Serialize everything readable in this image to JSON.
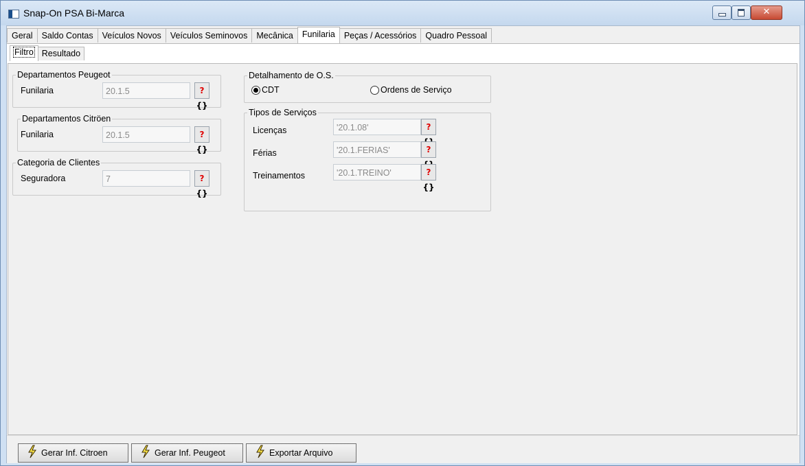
{
  "window": {
    "title": "Snap-On PSA Bi-Marca",
    "close_glyph": "✕"
  },
  "main_tabs": [
    "Geral",
    "Saldo Contas",
    "Veículos Novos",
    "Veículos Seminovos",
    "Mecânica",
    "Funilaria",
    "Peças / Acessórios",
    "Quadro Pessoal"
  ],
  "active_main_tab": "Funilaria",
  "sub_tabs": [
    "Filtro",
    "Resultado"
  ],
  "active_sub_tab": "Filtro",
  "groups": {
    "peugeot": {
      "legend": "Departamentos Peugeot",
      "label": "Funilaria",
      "value": "20.1.5"
    },
    "citroen": {
      "legend": "Departamentos Citröen",
      "label": "Funilaria",
      "value": "20.1.5"
    },
    "clientes": {
      "legend": "Categoria de Clientes",
      "label": "Seguradora",
      "value": "7"
    },
    "detalhamento": {
      "legend": "Detalhamento de O.S.",
      "option_cdt": "CDT",
      "option_os": "Ordens de Serviço",
      "selected": "CDT"
    },
    "servicos": {
      "legend": "Tipos de Serviços",
      "rows": [
        {
          "label": "Licenças",
          "value": "'20.1.08'"
        },
        {
          "label": "Férias",
          "value": "'20.1.FERIAS'"
        },
        {
          "label": "Treinamentos",
          "value": "'20.1.TREINO'"
        }
      ]
    }
  },
  "lookup_button": {
    "q": "?",
    "brace": "{}"
  },
  "buttons": {
    "gerar_citroen": "Gerar Inf. Citroen",
    "gerar_peugeot": "Gerar Inf. Peugeot",
    "exportar": "Exportar Arquivo"
  },
  "icons": {
    "app": "app-window-icon",
    "lookup": "lookup-icon",
    "action": "lightning-bolt-icon"
  }
}
